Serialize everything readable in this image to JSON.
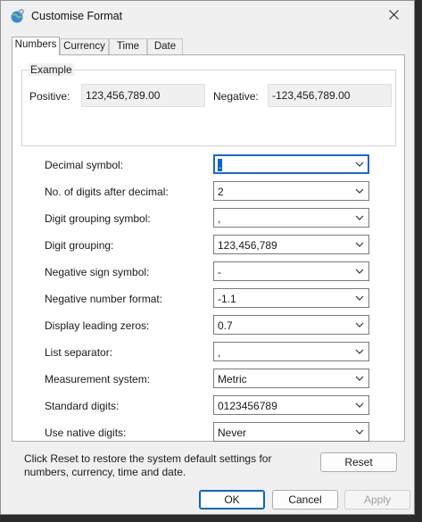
{
  "window": {
    "title": "Customise Format",
    "icon": "globe-settings-icon",
    "close_icon": "close-icon"
  },
  "tabs": [
    {
      "label": "Numbers",
      "active": true
    },
    {
      "label": "Currency",
      "active": false
    },
    {
      "label": "Time",
      "active": false
    },
    {
      "label": "Date",
      "active": false
    }
  ],
  "example": {
    "group_label": "Example",
    "positive_label": "Positive:",
    "positive_value": "123,456,789.00",
    "negative_label": "Negative:",
    "negative_value": "-123,456,789.00"
  },
  "settings": [
    {
      "label": "Decimal symbol:",
      "value": ".",
      "focused": true
    },
    {
      "label": "No. of digits after decimal:",
      "value": "2"
    },
    {
      "label": "Digit grouping symbol:",
      "value": ","
    },
    {
      "label": "Digit grouping:",
      "value": "123,456,789"
    },
    {
      "label": "Negative sign symbol:",
      "value": "-"
    },
    {
      "label": "Negative number format:",
      "value": "-1.1"
    },
    {
      "label": "Display leading zeros:",
      "value": "0.7"
    },
    {
      "label": "List separator:",
      "value": ","
    },
    {
      "label": "Measurement system:",
      "value": "Metric"
    },
    {
      "label": "Standard digits:",
      "value": "0123456789"
    },
    {
      "label": "Use native digits:",
      "value": "Never"
    }
  ],
  "reset": {
    "note": "Click Reset to restore the system default settings for numbers, currency, time and date.",
    "button": "Reset"
  },
  "footer": {
    "ok": "OK",
    "cancel": "Cancel",
    "apply": "Apply"
  },
  "colors": {
    "accent": "#0067c0",
    "selection": "#0063d1"
  }
}
